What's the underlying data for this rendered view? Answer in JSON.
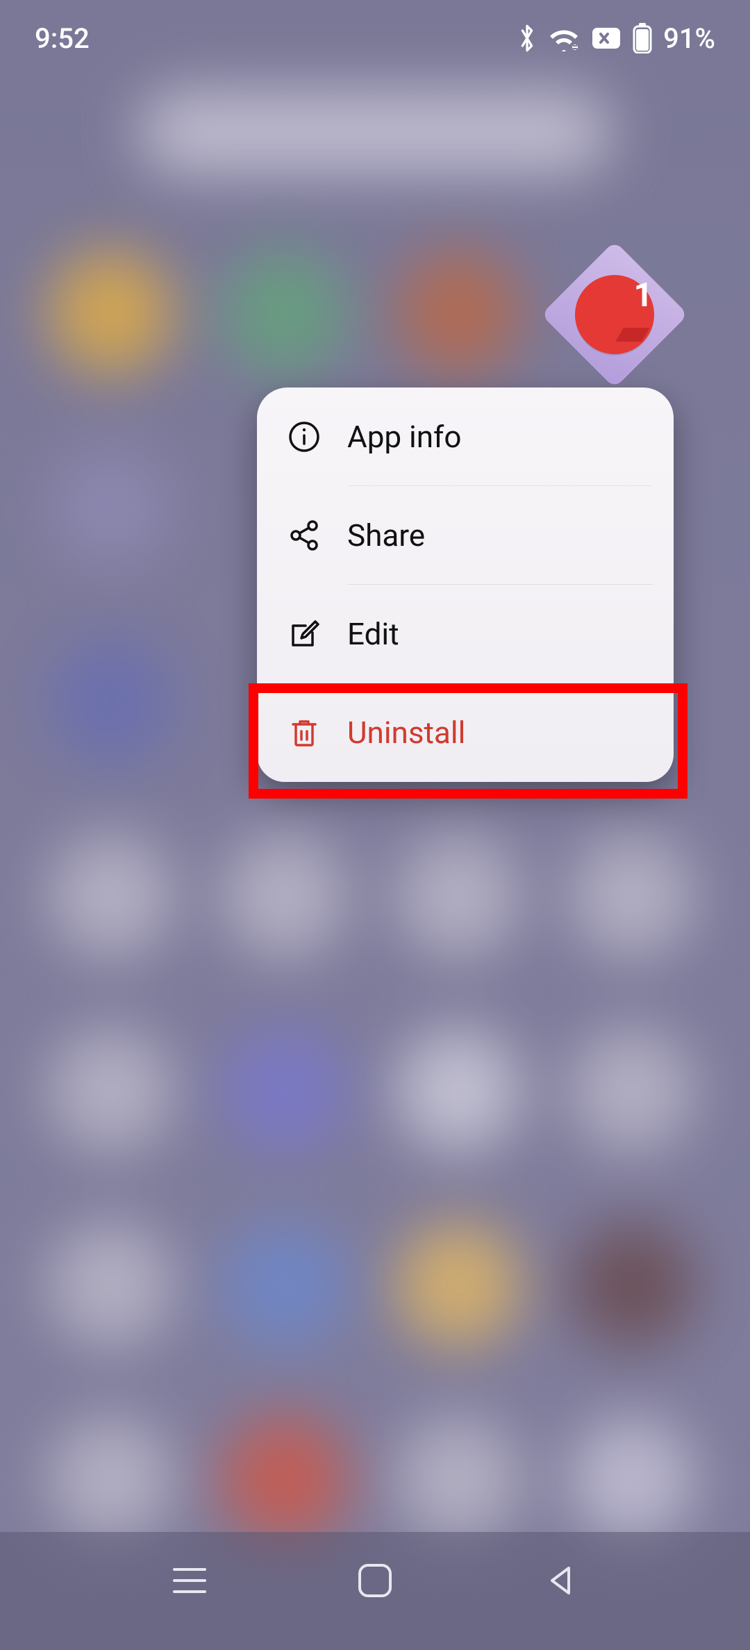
{
  "status": {
    "time": "9:52",
    "battery_pct": "91%"
  },
  "app_icon": {
    "badge": "1"
  },
  "popup": {
    "items": [
      {
        "label": "App info"
      },
      {
        "label": "Share"
      },
      {
        "label": "Edit"
      },
      {
        "label": "Uninstall"
      }
    ]
  }
}
